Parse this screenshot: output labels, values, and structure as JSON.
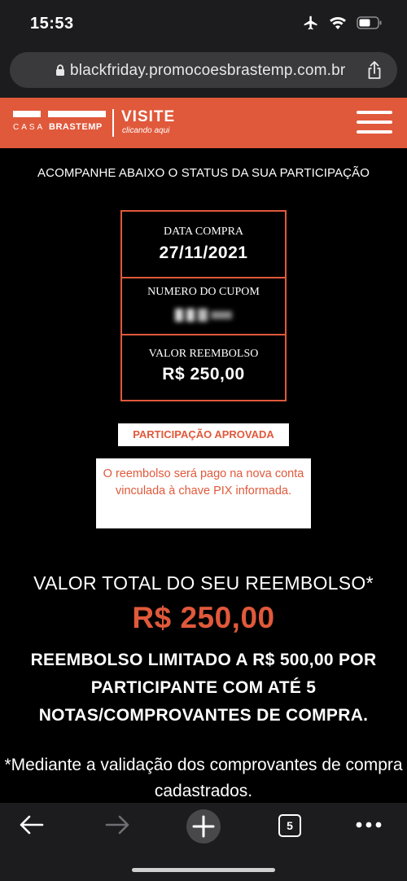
{
  "status_bar": {
    "time": "15:53"
  },
  "browser": {
    "url": "blackfriday.promocoesbrastemp.com.br",
    "tab_count": "5"
  },
  "site_header": {
    "logo_casa": "CASA",
    "logo_brand": "BRASTEMP",
    "visite": "VISITE",
    "clicando": "clicando aqui",
    "accent_color": "#e0593b"
  },
  "content": {
    "headline": "ACOMPANHE ABAIXO O STATUS DA SUA PARTICIPAÇÃO",
    "cards": [
      {
        "label": "DATA COMPRA",
        "value": "27/11/2021"
      },
      {
        "label": "NUMERO DO CUPOM",
        "value": ""
      },
      {
        "label": "VALOR REEMBOLSO",
        "value": "R$ 250,00"
      }
    ],
    "status_badge": "PARTICIPAÇÃO APROVADA",
    "status_message": "O reembolso será pago na nova conta vinculada à chave PIX informada.",
    "total_label": "VALOR TOTAL DO SEU REEMBOLSO*",
    "total_value": "R$ 250,00",
    "limit_text": "REEMBOLSO LIMITADO A R$ 500,00 POR PARTICIPANTE COM ATÉ 5 NOTAS/COMPROVANTES DE COMPRA.",
    "footnote": "*Mediante a validação dos comprovantes de compra cadastrados."
  }
}
